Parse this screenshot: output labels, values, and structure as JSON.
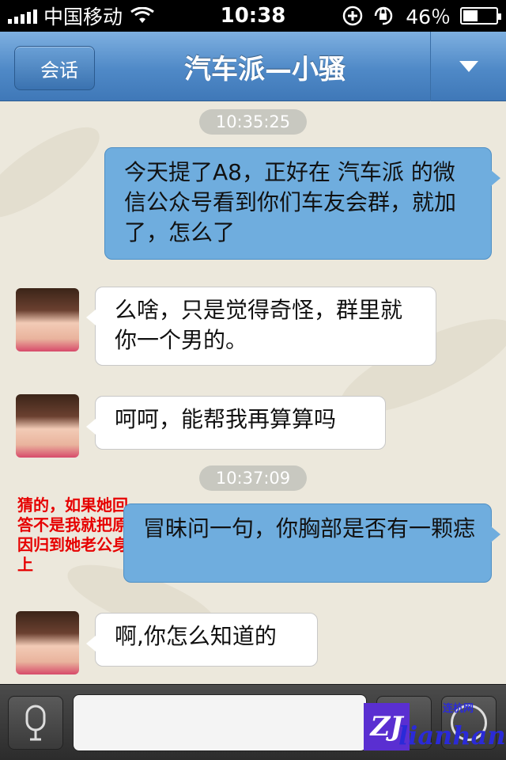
{
  "status_bar": {
    "carrier": "中国移动",
    "time": "10:38",
    "battery": "46％",
    "battery_level": 0.46
  },
  "nav": {
    "back_label": "会话",
    "title": "汽车派—小骚"
  },
  "messages": [
    {
      "type": "timestamp",
      "text": "10:35:25"
    },
    {
      "type": "out",
      "text": "今天提了A8，正好在 汽车派 的微信公众号看到你们车友会群，就加了，怎么了"
    },
    {
      "type": "in",
      "text": "么啥，只是觉得奇怪，群里就你一个男的。"
    },
    {
      "type": "in",
      "text": "呵呵，能帮我再算算吗"
    },
    {
      "type": "timestamp",
      "text": "10:37:09"
    },
    {
      "type": "out",
      "text": "冒昧问一句，你胸部是否有一颗痣"
    },
    {
      "type": "in",
      "text": "啊,你怎么知道的"
    }
  ],
  "annotation": "猜的，如果她回答不是我就把原因归到她老公身上",
  "input_bar": {
    "placeholder": ""
  },
  "watermark": {
    "logo": "ZJ",
    "cn": "连杭网",
    "en": "lianhang"
  },
  "colors": {
    "nav_blue": "#4f89c7",
    "outgoing_bubble": "#6fadde",
    "incoming_bubble": "#ffffff",
    "annotation_red": "#e60000"
  }
}
